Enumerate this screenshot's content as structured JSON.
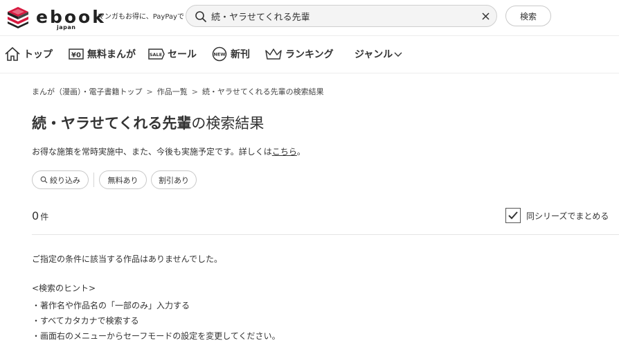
{
  "header": {
    "logo_word": "ebook",
    "logo_sub": "japan",
    "tagline": "マンガもお得に、PayPayで",
    "search_value": "続・ヤラせてくれる先輩",
    "search_button": "検索"
  },
  "nav": {
    "items": [
      {
        "label": "トップ",
        "icon": "home-icon"
      },
      {
        "label": "無料まんが",
        "icon": "free-yen-icon"
      },
      {
        "label": "セール",
        "icon": "sale-tag-icon"
      },
      {
        "label": "新刊",
        "icon": "new-badge-icon"
      },
      {
        "label": "ランキング",
        "icon": "crown-icon"
      },
      {
        "label": "ジャンル",
        "icon": "chevron-down-icon"
      }
    ]
  },
  "breadcrumb": [
    "まんが（漫画）・電子書籍トップ",
    "作品一覧",
    "続・ヤラせてくれる先輩の検索結果"
  ],
  "breadcrumb_sep": ">",
  "title": {
    "keyword": "続・ヤラせてくれる先輩",
    "suffix": "の検索結果"
  },
  "notice": {
    "text": "お得な施策を常時実施中、また、今後も実施予定です。詳しくは",
    "link": "こちら",
    "end": "。"
  },
  "filters": {
    "refine": "絞り込み",
    "free": "無料あり",
    "discount": "割引あり"
  },
  "results": {
    "count": "0",
    "unit": "件",
    "series_label": "同シリーズでまとめる",
    "series_checked": true
  },
  "empty": {
    "message": "ご指定の条件に該当する作品はありませんでした。",
    "hint_title": "<検索のヒント>",
    "hints": [
      "・著作名や作品名の「一部のみ」入力する",
      "・すべてカタカナで検索する",
      "・画面右のメニューからセーフモードの設定を変更してください。"
    ]
  },
  "colors": {
    "logo_red": "#d7193f",
    "text": "#333333",
    "border": "#c8c8c8"
  }
}
